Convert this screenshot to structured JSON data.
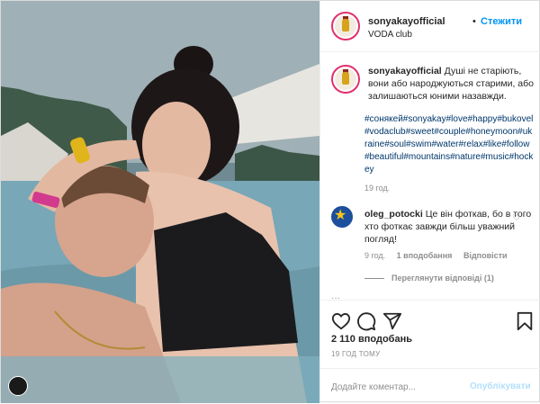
{
  "header": {
    "username": "sonyakayofficial",
    "separator": "•",
    "follow_label": "Стежити",
    "location": "VODA club"
  },
  "caption": {
    "username": "sonyakayofficial",
    "text": "Душі не старіють, вони або народжуються старими, або залишаються юними назавжди.",
    "hashtags": "#сонякей#sonyakay#love#happy#bukovel#vodaclub#sweet#couple#honeymoon#ukraine#soul#swim#water#relax#like#follow#beautiful#mountains#nature#music#hockey",
    "time": "19 год."
  },
  "comment": {
    "username": "oleg_potocki",
    "text": "Це він фоткав, бо в того хто фоткає завжди більш уважний погляд!",
    "time": "9 год.",
    "likes": "1 вподобання",
    "reply_label": "Відповісти",
    "view_replies": "Переглянути відповіді (1)"
  },
  "actions": {
    "likes_count": "2 110 вподобань",
    "posted_time": "19 ГОД ТОМУ"
  },
  "add_comment": {
    "placeholder": "Додайте коментар...",
    "post_label": "Опублікувати"
  },
  "icons": {
    "like": "heart-icon",
    "comment": "comment-icon",
    "share": "share-icon",
    "save": "bookmark-icon"
  },
  "colors": {
    "follow": "#0095f6",
    "hashtag": "#00376b",
    "muted": "#8e8e8e",
    "post_disabled": "#b2dffc"
  }
}
